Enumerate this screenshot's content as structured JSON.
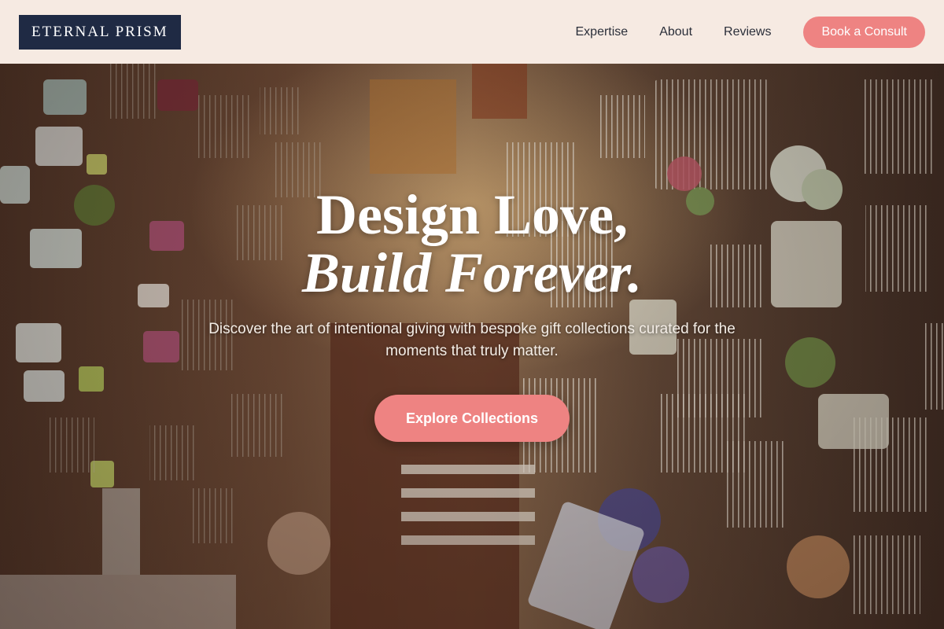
{
  "header": {
    "logo": "ETERNAL PRISM",
    "nav": [
      "Expertise",
      "About",
      "Reviews"
    ],
    "cta": "Book a Consult"
  },
  "hero": {
    "headline_line1": "Design Love,",
    "headline_line2": "Build Forever.",
    "subtext": "Discover the art of intentional giving with bespoke gift collections curated for the moments that truly matter.",
    "cta": "Explore Collections",
    "background": "photo-of-shop-with-hanging-birdcages-and-watering-cans"
  },
  "colors": {
    "logo_bg": "#1f2a44",
    "accent": "#ee8382",
    "header_bg": "#fcf1e9"
  }
}
